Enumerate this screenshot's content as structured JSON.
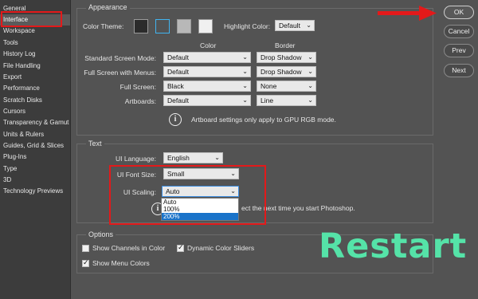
{
  "sidebar": {
    "items": [
      {
        "label": "General"
      },
      {
        "label": "Interface",
        "active": true
      },
      {
        "label": "Workspace"
      },
      {
        "label": "Tools"
      },
      {
        "label": "History Log"
      },
      {
        "label": "File Handling"
      },
      {
        "label": "Export"
      },
      {
        "label": "Performance"
      },
      {
        "label": "Scratch Disks"
      },
      {
        "label": "Cursors"
      },
      {
        "label": "Transparency & Gamut"
      },
      {
        "label": "Units & Rulers"
      },
      {
        "label": "Guides, Grid & Slices"
      },
      {
        "label": "Plug-Ins"
      },
      {
        "label": "Type"
      },
      {
        "label": "3D"
      },
      {
        "label": "Technology Previews"
      }
    ]
  },
  "appearance": {
    "title": "Appearance",
    "color_theme_label": "Color Theme:",
    "highlight_label": "Highlight Color:",
    "highlight_value": "Default",
    "col_color": "Color",
    "col_border": "Border",
    "rows": [
      {
        "label": "Standard Screen Mode:",
        "color": "Default",
        "border": "Drop Shadow"
      },
      {
        "label": "Full Screen with Menus:",
        "color": "Default",
        "border": "Drop Shadow"
      },
      {
        "label": "Full Screen:",
        "color": "Black",
        "border": "None"
      },
      {
        "label": "Artboards:",
        "color": "Default",
        "border": "Line"
      }
    ],
    "info_text": "Artboard settings only apply to GPU RGB mode."
  },
  "text_section": {
    "title": "Text",
    "ui_language_label": "UI Language:",
    "ui_language_value": "English",
    "ui_font_size_label": "UI Font Size:",
    "ui_font_size_value": "Small",
    "ui_scaling_label": "UI Scaling:",
    "ui_scaling_value": "Auto",
    "scaling_options": [
      "Auto",
      "100%",
      "200%"
    ],
    "info_text_partial": "ect the next time you start Photoshop."
  },
  "options": {
    "title": "Options",
    "show_channels": "Show Channels in Color",
    "dynamic_sliders": "Dynamic Color Sliders",
    "show_menu_colors": "Show Menu Colors"
  },
  "buttons": {
    "ok": "OK",
    "cancel": "Cancel",
    "prev": "Prev",
    "next": "Next"
  },
  "overlay": {
    "restart": "Restart"
  },
  "colors": {
    "accent_red": "#e3191a",
    "highlight_blue": "#1a73c9",
    "restart_green": "#55e3a8"
  }
}
